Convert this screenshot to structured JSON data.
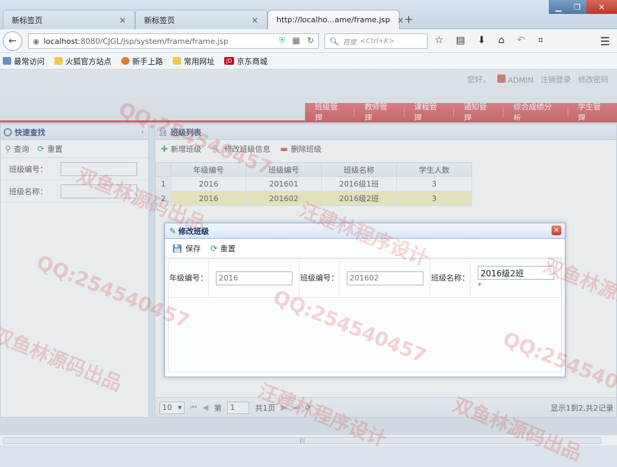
{
  "browser": {
    "tabs": [
      {
        "title": "新标签页",
        "close": "×"
      },
      {
        "title": "新标签页",
        "close": "×"
      },
      {
        "title": "http://localho...ame/frame.jsp",
        "close": "×"
      }
    ],
    "new_tab": "+",
    "window_controls": {
      "min": "▁",
      "max": "❐",
      "close": "✕"
    },
    "url_host": "localhost",
    "url_rest": ":8080/CJGL/jsp/system/frame/frame.jsp",
    "search_engine": "百度",
    "search_placeholder": "<Ctrl+K>",
    "bookmarks": [
      {
        "label": "最常访问",
        "icon": "book-icon"
      },
      {
        "label": "火狐官方站点",
        "icon": "folder-icon"
      },
      {
        "label": "新手上路",
        "icon": "firefox-icon"
      },
      {
        "label": "常用网址",
        "icon": "folder-icon"
      },
      {
        "label": "京东商城",
        "icon": "jd-icon",
        "badge": "JD"
      }
    ]
  },
  "header": {
    "greeting": "您好，",
    "user": "ADMIN",
    "logout": "注销登录",
    "change_password": "修改密码",
    "menu": [
      "班级管理",
      "教师管理",
      "课程管理",
      "通知管理",
      "综合成绩分析",
      "学生管理"
    ]
  },
  "left_panel": {
    "title": "快速查找",
    "search_button": "查询",
    "reset_button": "重置",
    "fields": [
      {
        "label": "班级编号：",
        "value": ""
      },
      {
        "label": "班级名称：",
        "value": ""
      }
    ]
  },
  "right_panel": {
    "title": "班级列表",
    "toolbar": {
      "add": "新增班级",
      "edit": "修改班级信息",
      "delete": "删除班级"
    },
    "columns": [
      "年级编号",
      "班级编号",
      "班级名称",
      "学生人数"
    ],
    "rows": [
      {
        "rownum": "1",
        "grade": "2016",
        "class_id": "201601",
        "class_name": "2016级1班",
        "count": "3"
      },
      {
        "rownum": "2",
        "grade": "2016",
        "class_id": "201602",
        "class_name": "2016级2班",
        "count": "3"
      }
    ],
    "pager": {
      "page_size": "10",
      "page_label_pre": "第",
      "page_value": "1",
      "page_label_post": "共1页",
      "summary": "显示1到2,共2记录"
    }
  },
  "dialog": {
    "title": "修改班级",
    "save": "保存",
    "reset": "重置",
    "fields": {
      "grade_label": "年级编号：",
      "grade_value": "2016",
      "class_id_label": "班级编号：",
      "class_id_value": "201602",
      "class_name_label": "班级名称：",
      "class_name_value": "2016级2班",
      "required_mark": "*"
    }
  },
  "watermarks": [
    "QQ:254540457",
    "汪建林程序设计",
    "双鱼林源码出品"
  ],
  "colors": {
    "accent_red": "#c93435",
    "title_blue": "#0e2d5f",
    "selected_row": "#f7edb1"
  }
}
